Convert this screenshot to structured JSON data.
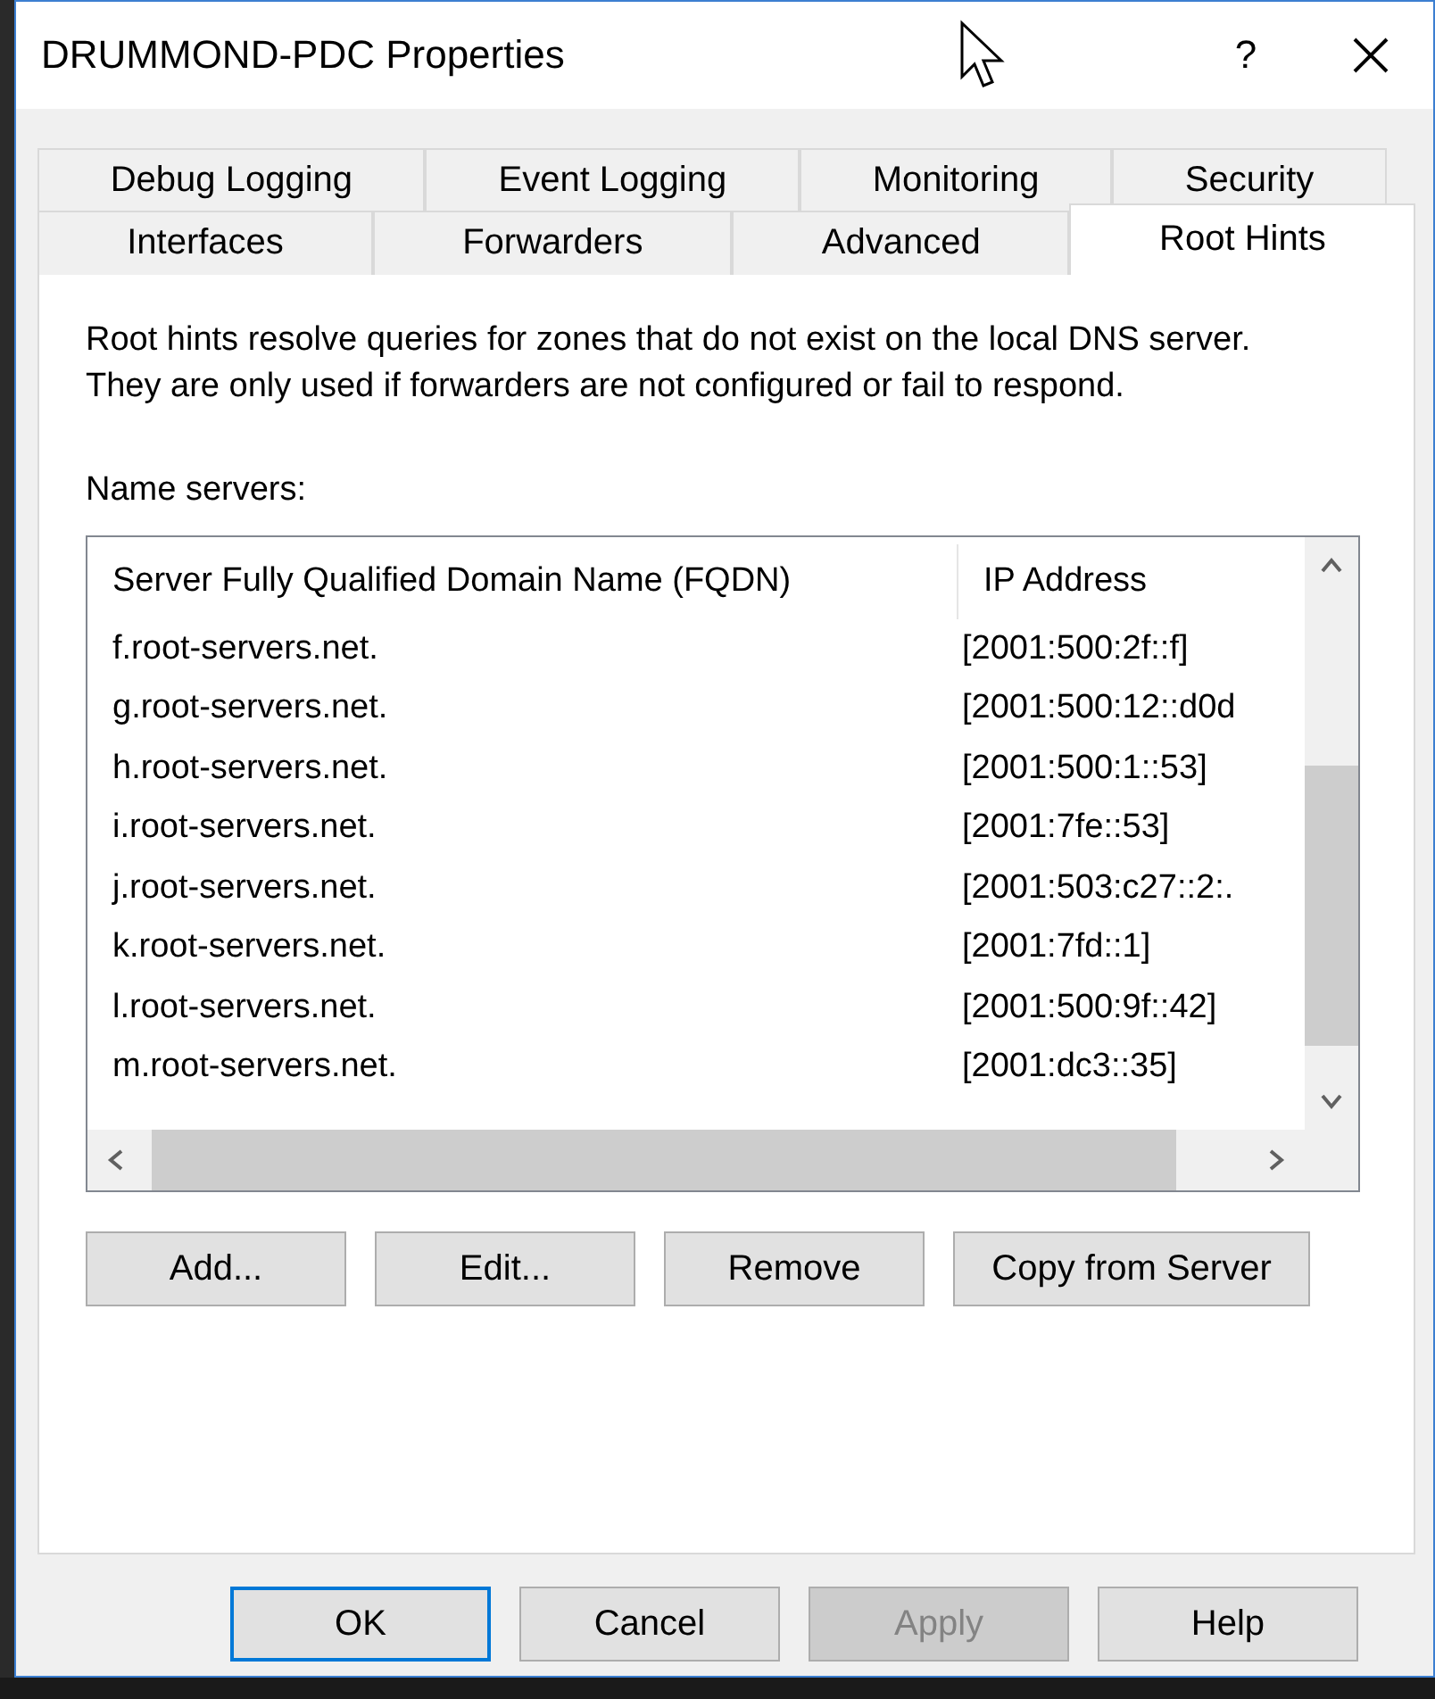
{
  "window": {
    "title": "DRUMMOND-PDC Properties",
    "help": "?"
  },
  "tab_rows": [
    [
      {
        "label": "Debug Logging",
        "selected": false
      },
      {
        "label": "Event Logging",
        "selected": false
      },
      {
        "label": "Monitoring",
        "selected": false
      },
      {
        "label": "Security",
        "selected": false
      }
    ],
    [
      {
        "label": "Interfaces",
        "selected": false
      },
      {
        "label": "Forwarders",
        "selected": false
      },
      {
        "label": "Advanced",
        "selected": false
      },
      {
        "label": "Root Hints",
        "selected": true
      }
    ]
  ],
  "description": "Root hints resolve queries for zones that do not exist on the local DNS server.   They are only used if forwarders are not configured or fail to respond.",
  "list_label": "Name servers:",
  "table": {
    "columns": [
      "Server Fully Qualified Domain Name (FQDN)",
      "IP Address"
    ],
    "rows": [
      {
        "fqdn": "f.root-servers.net.",
        "ip": "[2001:500:2f::f]"
      },
      {
        "fqdn": "g.root-servers.net.",
        "ip": "[2001:500:12::d0d"
      },
      {
        "fqdn": "h.root-servers.net.",
        "ip": "[2001:500:1::53]"
      },
      {
        "fqdn": "i.root-servers.net.",
        "ip": "[2001:7fe::53]"
      },
      {
        "fqdn": "j.root-servers.net.",
        "ip": "[2001:503:c27::2:."
      },
      {
        "fqdn": "k.root-servers.net.",
        "ip": "[2001:7fd::1]"
      },
      {
        "fqdn": "l.root-servers.net.",
        "ip": "[2001:500:9f::42]"
      },
      {
        "fqdn": "m.root-servers.net.",
        "ip": "[2001:dc3::35]"
      }
    ]
  },
  "list_buttons": [
    {
      "label": "Add...",
      "disabled": false
    },
    {
      "label": "Edit...",
      "disabled": false
    },
    {
      "label": "Remove",
      "disabled": false
    },
    {
      "label": "Copy from Server",
      "disabled": false
    }
  ],
  "dialog_buttons": [
    {
      "label": "OK",
      "default": true,
      "disabled": false
    },
    {
      "label": "Cancel",
      "default": false,
      "disabled": false
    },
    {
      "label": "Apply",
      "default": false,
      "disabled": true
    },
    {
      "label": "Help",
      "default": false,
      "disabled": false
    }
  ]
}
